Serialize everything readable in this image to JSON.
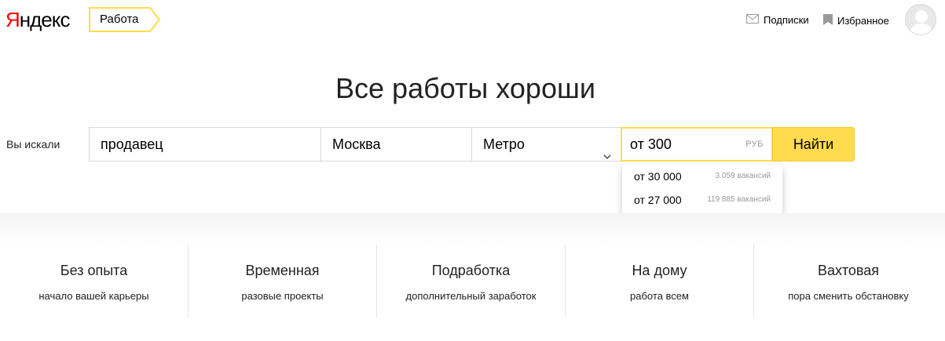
{
  "header": {
    "logo_text_y": "Я",
    "logo_text_rest": "ндекс",
    "service": "Работа",
    "subscriptions": "Подписки",
    "favorites": "Избранное"
  },
  "hero": {
    "title": "Все работы хороши"
  },
  "search": {
    "label": "Вы искали",
    "query": "продавец",
    "city": "Москва",
    "metro": "Метро",
    "salary": "от 300",
    "salary_unit": "РУБ",
    "button": "Найти"
  },
  "suggestions": [
    {
      "value": "от 30 000",
      "count": "3 059 вакансий"
    },
    {
      "value": "от 27 000",
      "count": "119 885 вакансий"
    }
  ],
  "categories": [
    {
      "title": "Без опыта",
      "subtitle": "начало вашей карьеры"
    },
    {
      "title": "Временная",
      "subtitle": "разовые проекты"
    },
    {
      "title": "Подработка",
      "subtitle": "дополнительный заработок"
    },
    {
      "title": "На дому",
      "subtitle": "работа всем"
    },
    {
      "title": "Вахтовая",
      "subtitle": "пора сменить обстановку"
    }
  ],
  "colors": {
    "accent": "#ffdb4d",
    "logo_red": "#ff0000"
  }
}
